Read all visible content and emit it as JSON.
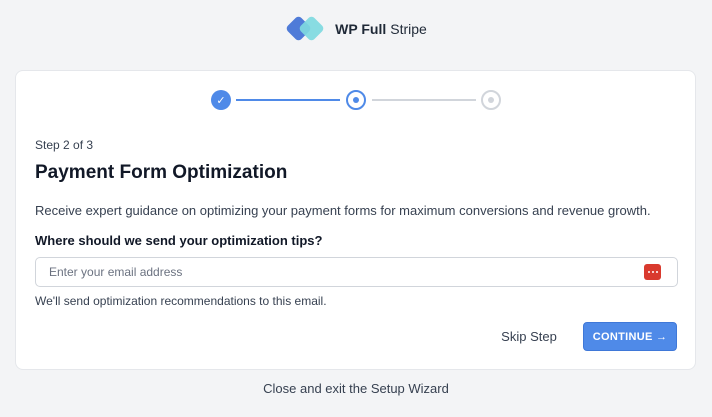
{
  "header": {
    "logo_icon": "wp-full-stripe-logo-icon",
    "brand_bold": "WP Full",
    "brand_light": "Stripe"
  },
  "stepper": {
    "steps": [
      {
        "status": "completed",
        "icon": "check-icon"
      },
      {
        "status": "current"
      },
      {
        "status": "upcoming"
      }
    ],
    "check_glyph": "✓"
  },
  "content": {
    "step_label": "Step 2 of 3",
    "title": "Payment Form Optimization",
    "description": "Receive expert guidance on optimizing your payment forms for maximum conversions and revenue growth.",
    "question": "Where should we send your optimization tips?",
    "email": {
      "value": "",
      "placeholder": "Enter your email address"
    },
    "password_manager_icon": "password-manager-icon",
    "hint": "We'll send optimization recommendations to this email."
  },
  "actions": {
    "skip_label": "Skip Step",
    "continue_label": "CONTINUE →"
  },
  "footer": {
    "close_label": "Close and exit the Setup Wizard"
  },
  "colors": {
    "accent": "#4f8ae8",
    "logo_blue": "#4f7bd8",
    "logo_teal": "#7fd9e0",
    "password_icon_red": "#d93a2e"
  }
}
